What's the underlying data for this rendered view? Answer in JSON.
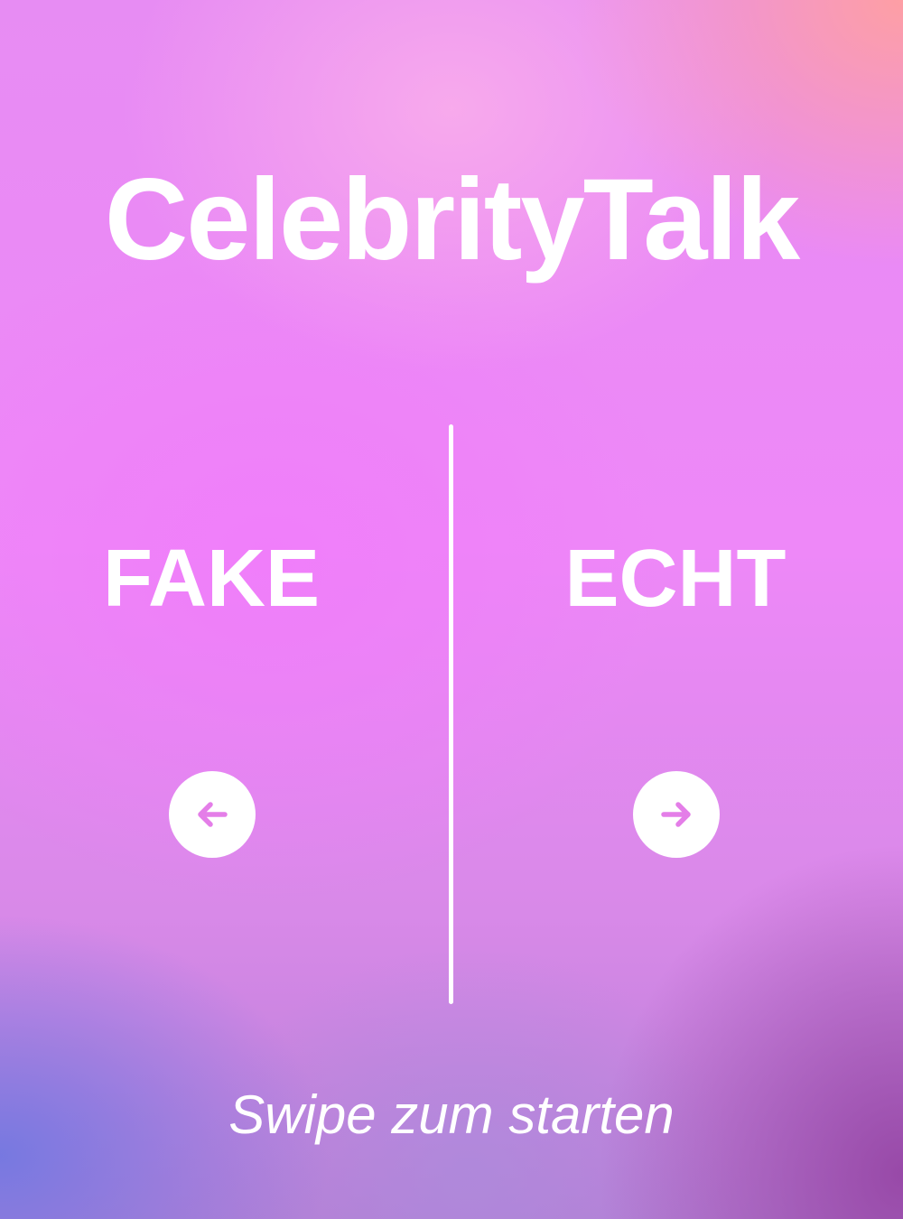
{
  "app": {
    "title": "CelebrityTalk"
  },
  "choices": {
    "left": {
      "label": "FAKE",
      "icon": "arrow-left-icon"
    },
    "right": {
      "label": "ECHT",
      "icon": "arrow-right-icon"
    }
  },
  "footer": {
    "hint": "Swipe zum starten"
  },
  "colors": {
    "text": "#ffffff",
    "arrow": "#e47ee8",
    "gradient_top_right": "#ffa0a0",
    "gradient_center": "#ee88f8",
    "gradient_bottom_left": "#7378e1",
    "gradient_bottom_right": "#9646a5"
  }
}
